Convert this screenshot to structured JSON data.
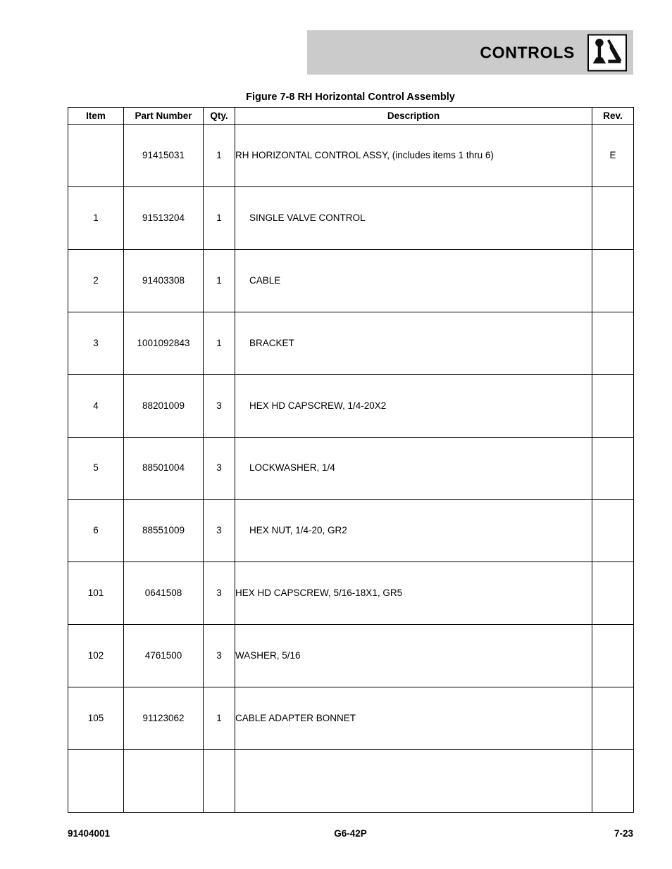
{
  "header": {
    "section_title": "CONTROLS",
    "icon_name": "joystick-control-icon",
    "bar_color": "#cbcbcb"
  },
  "figure": {
    "title": "Figure 7-8 RH Horizontal Control Assembly"
  },
  "table": {
    "columns": [
      "Item",
      "Part Number",
      "Qty.",
      "Description",
      "Rev."
    ],
    "rows": [
      {
        "item": "",
        "part": "91415031",
        "qty": "1",
        "description": "RH HORIZONTAL CONTROL ASSY, (includes items 1 thru 6)",
        "rev": "E",
        "indent": false
      },
      {
        "item": "1",
        "part": "91513204",
        "qty": "1",
        "description": "SINGLE VALVE CONTROL",
        "rev": "",
        "indent": true
      },
      {
        "item": "2",
        "part": "91403308",
        "qty": "1",
        "description": "CABLE",
        "rev": "",
        "indent": true
      },
      {
        "item": "3",
        "part": "1001092843",
        "qty": "1",
        "description": "BRACKET",
        "rev": "",
        "indent": true
      },
      {
        "item": "4",
        "part": "88201009",
        "qty": "3",
        "description": "HEX HD CAPSCREW, 1/4-20X2",
        "rev": "",
        "indent": true
      },
      {
        "item": "5",
        "part": "88501004",
        "qty": "3",
        "description": "LOCKWASHER, 1/4",
        "rev": "",
        "indent": true
      },
      {
        "item": "6",
        "part": "88551009",
        "qty": "3",
        "description": "HEX NUT, 1/4-20, GR2",
        "rev": "",
        "indent": true
      },
      {
        "item": "101",
        "part": "0641508",
        "qty": "3",
        "description": "HEX HD CAPSCREW, 5/16-18X1, GR5",
        "rev": "",
        "indent": false
      },
      {
        "item": "102",
        "part": "4761500",
        "qty": "3",
        "description": "WASHER, 5/16",
        "rev": "",
        "indent": false
      },
      {
        "item": "105",
        "part": "91123062",
        "qty": "1",
        "description": "CABLE ADAPTER BONNET",
        "rev": "",
        "indent": false
      }
    ]
  },
  "footer": {
    "doc_number": "91404001",
    "model": "G6-42P",
    "page_number": "7-23"
  }
}
